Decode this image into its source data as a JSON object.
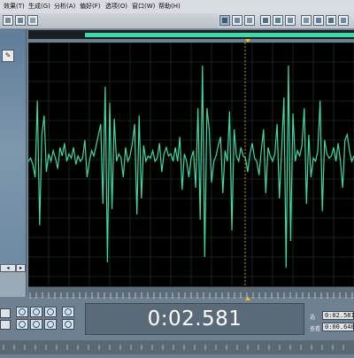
{
  "menu": [
    {
      "label": "效果(T)"
    },
    {
      "label": "生成(G)"
    },
    {
      "label": "分析(A)"
    },
    {
      "label": "偏好(F)"
    },
    {
      "label": "选项(O)"
    },
    {
      "label": "窗口(W)"
    },
    {
      "label": "帮助(H)"
    }
  ],
  "time_display": "0:02.581",
  "selection": {
    "start_label": "选",
    "start_value": "0:02.581",
    "view_label": "查看",
    "view_value": "0:00.640"
  },
  "colors": {
    "waveform": "#3fd8a8",
    "grid": "#24403a",
    "marker": "#f2c21c"
  },
  "waveform_samples": [
    0.05,
    0.08,
    0.02,
    -0.1,
    0.62,
    -0.55,
    0.3,
    0.48,
    -0.05,
    0.12,
    0.05,
    0.15,
    0.08,
    -0.02,
    0.18,
    0.1,
    0.22,
    0.05,
    0.12,
    0.08,
    0.18,
    0.02,
    0.1,
    0.05,
    0.08,
    0.25,
    -0.1,
    0.05,
    0.15,
    0.1,
    0.2,
    0.3,
    0.4,
    -0.35,
    0.75,
    -0.9,
    0.6,
    -0.4,
    0.45,
    0.05,
    0.12,
    0.08,
    -0.1,
    0.18,
    0.05,
    0.1,
    0.22,
    0.4,
    -0.45,
    0.48,
    -0.3,
    0.2,
    0.05,
    0.1,
    0.08,
    0.15,
    0.05,
    0.08,
    0.22,
    -0.05,
    0.12,
    0.18,
    0.1,
    0.12,
    0.05,
    0.18,
    0.05,
    0.28,
    -0.22,
    0.12,
    0.05,
    -0.1,
    0.08,
    0.15,
    -0.2,
    0.55,
    -0.5,
    0.95,
    -0.85,
    0.55,
    0.35,
    -0.15,
    0.05,
    0.1,
    0.2,
    0.28,
    -0.25,
    0.15,
    0.05,
    0.52,
    -0.6,
    0.35,
    0.1,
    0.05,
    0.18,
    0.1,
    0.08,
    -0.05,
    0.12,
    0.22,
    0.08,
    0.05,
    -0.08,
    0.15,
    0.35,
    -0.25,
    0.18,
    0.1,
    0.05,
    0.12,
    0.4,
    -0.3,
    0.15,
    0.65,
    -0.95,
    0.95,
    -0.7,
    0.5,
    0.05,
    0.15,
    0.1,
    0.2,
    0.55,
    -0.35,
    0.3,
    -0.1,
    0.08,
    0.05,
    0.15,
    0.62,
    -0.42,
    0.25,
    0.12,
    0.08,
    0.1,
    0.18,
    0.05,
    0.22,
    0.05,
    -0.2,
    0.25,
    0.3,
    0.15,
    0.05,
    0.1
  ]
}
